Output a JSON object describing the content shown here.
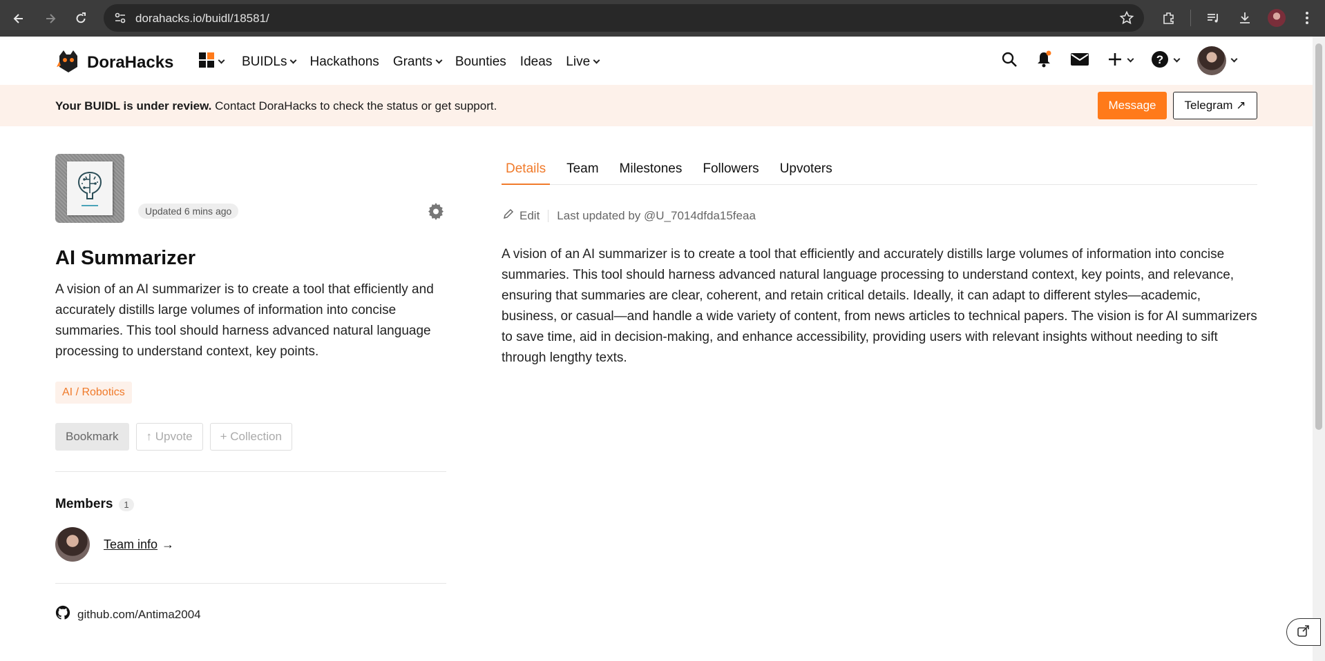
{
  "browser": {
    "url": "dorahacks.io/buidl/18581/"
  },
  "header": {
    "brand": "DoraHacks",
    "nav": [
      {
        "label": "BUIDLs"
      },
      {
        "label": "Hackathons"
      },
      {
        "label": "Grants"
      },
      {
        "label": "Bounties"
      },
      {
        "label": "Ideas"
      },
      {
        "label": "Live"
      }
    ]
  },
  "banner": {
    "bold": "Your BUIDL is under review.",
    "text": " Contact DoraHacks to check the status or get support.",
    "message_label": "Message",
    "telegram_label": "Telegram ↗"
  },
  "project": {
    "updated": "Updated 6 mins ago",
    "title": "AI Summarizer",
    "description": "A vision of an AI summarizer is to create a tool that efficiently and accurately distills large volumes of information into concise summaries. This tool should harness advanced natural language processing to understand context, key points.",
    "tag": "AI / Robotics",
    "actions": {
      "bookmark": "Bookmark",
      "upvote": "↑ Upvote",
      "collection": "+ Collection"
    },
    "members_label": "Members",
    "members_count": "1",
    "team_info": "Team info",
    "team_arrow": "→",
    "github": "github.com/Antima2004"
  },
  "tabs": [
    {
      "label": "Details"
    },
    {
      "label": "Team"
    },
    {
      "label": "Milestones"
    },
    {
      "label": "Followers"
    },
    {
      "label": "Upvoters"
    }
  ],
  "details": {
    "edit_label": "Edit",
    "last_updated": "Last updated by @U_7014dfda15feaa",
    "body": "A vision of an AI summarizer is to create a tool that efficiently and accurately distills large volumes of information into concise summaries. This tool should harness advanced natural language processing to understand context, key points, and relevance, ensuring that summaries are clear, coherent, and retain critical details. Ideally, it can adapt to different styles—academic, business, or casual—and handle a wide variety of content, from news articles to technical papers. The vision is for AI summarizers to save time, aid in decision-making, and enhance accessibility, providing users with relevant insights without needing to sift through lengthy texts."
  },
  "colors": {
    "accent": "#ff7a1a",
    "banner_bg": "#fdf1ea",
    "chrome_bg": "#3c3c3c"
  },
  "icons": [
    "back-icon",
    "forward-icon",
    "reload-icon",
    "site-info-icon",
    "star-icon",
    "extensions-icon",
    "media-icon",
    "download-icon",
    "profile-icon",
    "more-icon",
    "dorahacks-logo-icon",
    "grid-icon",
    "search-icon",
    "bell-icon",
    "mail-icon",
    "plus-icon",
    "help-icon",
    "gear-icon",
    "pencil-icon",
    "github-icon",
    "share-icon"
  ]
}
